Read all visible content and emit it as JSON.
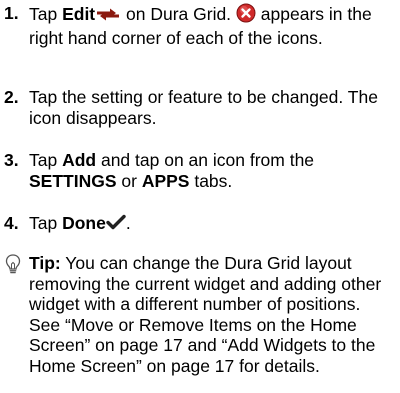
{
  "steps": [
    {
      "number": "1.",
      "text_a": "Tap ",
      "bold_a": "Edit",
      "text_b": " on Dura Grid. ",
      "text_c": " appears in the right hand corner of each of the icons."
    },
    {
      "number": "2.",
      "text_a": "Tap the setting or feature to be changed. The icon disappears."
    },
    {
      "number": "3.",
      "text_a": "Tap ",
      "bold_a": "Add",
      "text_b": " and tap on an icon from the ",
      "bold_b": "SETTINGS",
      "text_c": " or ",
      "bold_c": "APPS",
      "text_d": " tabs."
    },
    {
      "number": "4.",
      "text_a": "Tap ",
      "bold_a": "Done",
      "text_b": "."
    }
  ],
  "tip": {
    "label": "Tip:",
    "text": " You can change the Dura Grid layout removing the current widget and adding other widget with a different number of positions. See “Move or Remove Items on the Home Screen” on page 17 and “Add Widgets to the Home Screen” on page 17 for details."
  },
  "icons": {
    "edit": "edit-arrows-icon",
    "remove": "remove-badge-icon",
    "done": "checkmark-icon",
    "tip": "lightbulb-icon"
  },
  "colors": {
    "edit_arrows": "#8b1a10",
    "remove_badge": "#d02a2a",
    "check": "#222222"
  }
}
